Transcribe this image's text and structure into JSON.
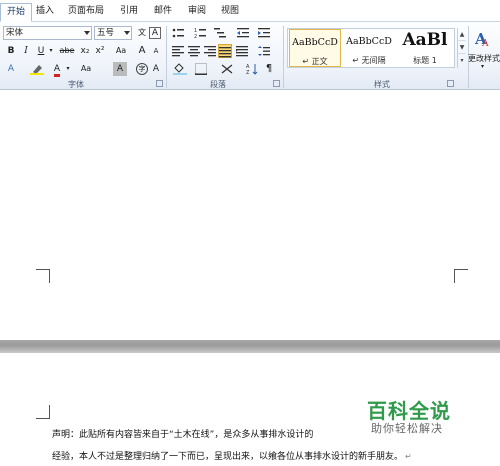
{
  "tabs": [
    "开始",
    "插入",
    "页面布局",
    "引用",
    "邮件",
    "审阅",
    "视图"
  ],
  "active_tab": "开始",
  "font_group": {
    "font_name": "宋体",
    "font_size": "五号",
    "label": "字体",
    "buttons": {
      "bold": "B",
      "italic": "I",
      "underline": "U",
      "strike": "abe",
      "subscript": "x₂",
      "superscript": "x²",
      "grow": "A",
      "shrink": "A",
      "clear": "A",
      "phonetic": "文",
      "border_char": "A",
      "text_effect": "A",
      "highlight": "aby",
      "font_color": "A",
      "case": "Aa",
      "shade_char": "A",
      "circle_char": "字"
    }
  },
  "paragraph_group": {
    "label": "段落"
  },
  "styles_group": {
    "label": "样式",
    "items": [
      {
        "sample": "AaBbCcD",
        "name": "↵ 正文"
      },
      {
        "sample": "AaBbCcD",
        "name": "↵ 无间隔"
      },
      {
        "sample": "AaBl",
        "name": "标题 1"
      }
    ],
    "change_styles": "更改样式"
  },
  "accent_colors": {
    "tab_active": "#1f3d6b",
    "highlight": "#f8d878",
    "font_color": "#d81e1e",
    "watermark": "#2f9a4a"
  },
  "document": {
    "line1": "声明：此贴所有内容皆来自于“土木在线”，是众多从事排水设计的",
    "line2": "经验，本人不过是整理归纳了一下而已，呈现出来，以飨各位从事排水设计的新手朋友。"
  },
  "watermark": {
    "title": "百科全说",
    "subtitle": "助你轻松解决"
  }
}
